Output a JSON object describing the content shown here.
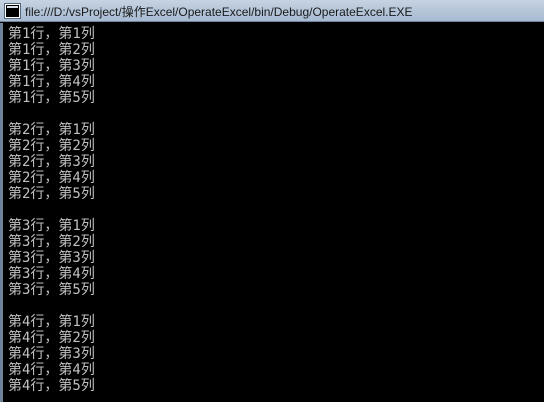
{
  "window": {
    "title": "file:///D:/vsProject/操作Excel/OperateExcel/bin/Debug/OperateExcel.EXE"
  },
  "console": {
    "groups": [
      {
        "lines": [
          "第1行，第1列",
          "第1行，第2列",
          "第1行，第3列",
          "第1行，第4列",
          "第1行，第5列"
        ]
      },
      {
        "lines": [
          "第2行，第1列",
          "第2行，第2列",
          "第2行，第3列",
          "第2行，第4列",
          "第2行，第5列"
        ]
      },
      {
        "lines": [
          "第3行，第1列",
          "第3行，第2列",
          "第3行，第3列",
          "第3行，第4列",
          "第3行，第5列"
        ]
      },
      {
        "lines": [
          "第4行，第1列",
          "第4行，第2列",
          "第4行，第3列",
          "第4行，第4列",
          "第4行，第5列"
        ]
      }
    ]
  }
}
